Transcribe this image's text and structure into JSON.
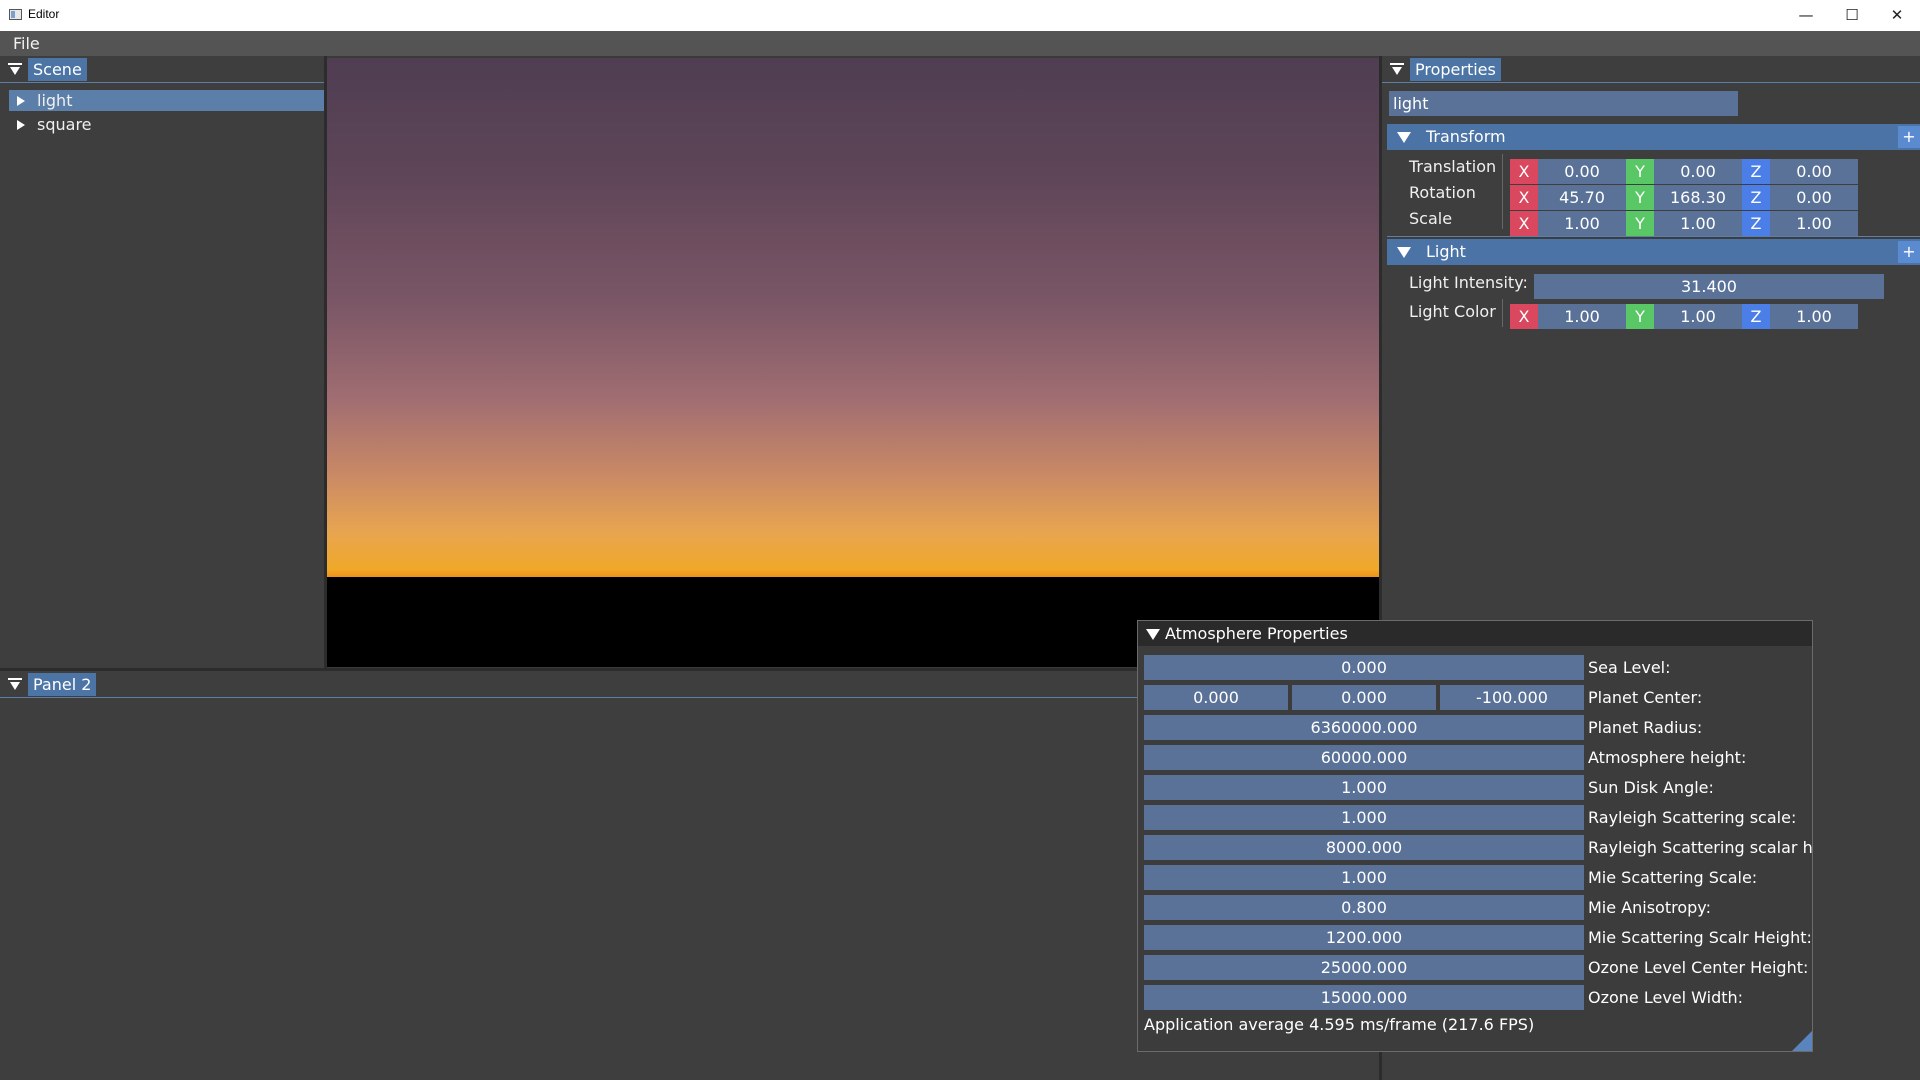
{
  "window": {
    "title": "Editor",
    "minimize": "—",
    "maximize": "☐",
    "close": "✕"
  },
  "menu": {
    "file": "File"
  },
  "scene_panel": {
    "tab": "Scene",
    "items": [
      {
        "label": "light"
      },
      {
        "label": "square"
      }
    ]
  },
  "panel2": {
    "tab": "Panel 2"
  },
  "properties": {
    "tab": "Properties",
    "name_value": "light",
    "transform": {
      "header": "Transform",
      "add": "+",
      "rows": [
        {
          "label": "Translation",
          "x": "0.00",
          "y": "0.00",
          "z": "0.00"
        },
        {
          "label": "Rotation",
          "x": "45.70",
          "y": "168.30",
          "z": "0.00"
        },
        {
          "label": "Scale",
          "x": "1.00",
          "y": "1.00",
          "z": "1.00"
        }
      ]
    },
    "light": {
      "header": "Light",
      "add": "+",
      "intensity_label": "Light Intensity:",
      "intensity_value": "31.400",
      "color_label": "Light Color",
      "color": {
        "x": "1.00",
        "y": "1.00",
        "z": "1.00"
      }
    },
    "axis_labels": {
      "x": "X",
      "y": "Y",
      "z": "Z"
    }
  },
  "atmosphere": {
    "title": "Atmosphere Properties",
    "sea_level": {
      "value": "0.000",
      "label": "Sea Level:"
    },
    "planet_center": {
      "x": "0.000",
      "y": "0.000",
      "z": "-100.000",
      "label": "Planet Center:"
    },
    "rows": [
      {
        "value": "6360000.000",
        "label": "Planet Radius:"
      },
      {
        "value": "60000.000",
        "label": "Atmosphere height:"
      },
      {
        "value": "1.000",
        "label": "Sun Disk Angle:"
      },
      {
        "value": "1.000",
        "label": "Rayleigh Scattering scale:"
      },
      {
        "value": "8000.000",
        "label": "Rayleigh Scattering scalar hei"
      },
      {
        "value": "1.000",
        "label": "Mie Scattering Scale:"
      },
      {
        "value": "0.800",
        "label": "Mie Anisotropy:"
      },
      {
        "value": "1200.000",
        "label": "Mie Scattering Scalr Height:"
      },
      {
        "value": "25000.000",
        "label": "Ozone Level Center Height:"
      },
      {
        "value": "15000.000",
        "label": "Ozone Level Width:"
      }
    ],
    "fps_text": "Application average 4.595 ms/frame (217.6 FPS)"
  },
  "colors": {
    "accent": "#4c75a6",
    "axis_x": "#d9485e",
    "axis_y": "#5ac766",
    "axis_z": "#4b7ee6"
  }
}
